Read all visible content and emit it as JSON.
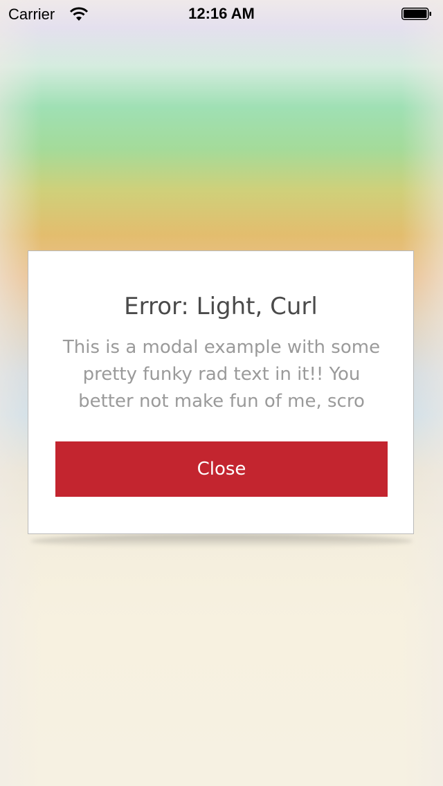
{
  "status_bar": {
    "carrier": "Carrier",
    "time": "12:16 AM"
  },
  "modal": {
    "title": "Error: Light, Curl",
    "message": "This is a modal example with some pretty funky rad text in it!! You better not make fun of me, scro",
    "close_label": "Close"
  },
  "colors": {
    "button_background": "#c3252f",
    "button_text": "#ffffff",
    "title_text": "#4a4a4a",
    "message_text": "#9a9a9a"
  },
  "icons": {
    "signal": "wifi-icon",
    "battery": "battery-icon"
  }
}
